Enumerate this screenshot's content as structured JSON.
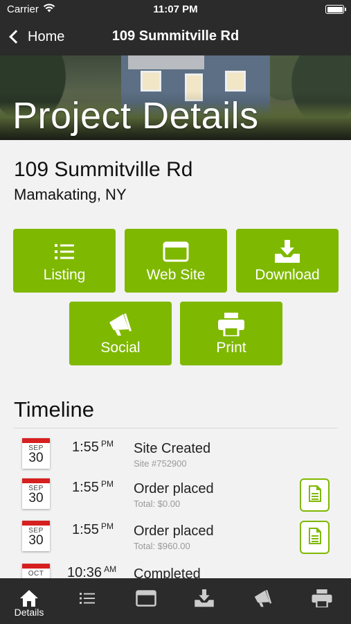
{
  "status_bar": {
    "carrier": "Carrier",
    "time": "11:07 PM"
  },
  "nav": {
    "back_label": "Home",
    "title": "109 Summitville Rd"
  },
  "hero": {
    "heading": "Project Details"
  },
  "address": {
    "street": "109 Summitville Rd",
    "city": "Mamakating, NY"
  },
  "actions": [
    {
      "label": "Listing",
      "icon": "list-icon"
    },
    {
      "label": "Web Site",
      "icon": "browser-window-icon"
    },
    {
      "label": "Download",
      "icon": "download-icon"
    },
    {
      "label": "Social",
      "icon": "megaphone-icon"
    },
    {
      "label": "Print",
      "icon": "printer-icon"
    }
  ],
  "timeline": {
    "title": "Timeline",
    "items": [
      {
        "month": "SEP",
        "day": "30",
        "time": "1:55",
        "ampm": "PM",
        "event": "Site Created",
        "detail": "Site #752900",
        "has_document": false
      },
      {
        "month": "SEP",
        "day": "30",
        "time": "1:55",
        "ampm": "PM",
        "event": "Order placed",
        "detail": "Total: $0.00",
        "has_document": true
      },
      {
        "month": "SEP",
        "day": "30",
        "time": "1:55",
        "ampm": "PM",
        "event": "Order placed",
        "detail": "Total: $960.00",
        "has_document": true
      },
      {
        "month": "OCT",
        "day": "",
        "time": "10:36",
        "ampm": "AM",
        "event": "Completed",
        "detail": "",
        "has_document": false
      }
    ]
  },
  "tab_bar": {
    "active_index": 0,
    "tabs": [
      {
        "label": "Details",
        "icon": "home-icon"
      },
      {
        "label": "",
        "icon": "list-icon"
      },
      {
        "label": "",
        "icon": "browser-window-icon"
      },
      {
        "label": "",
        "icon": "download-icon"
      },
      {
        "label": "",
        "icon": "megaphone-icon"
      },
      {
        "label": "",
        "icon": "printer-icon"
      }
    ]
  },
  "colors": {
    "accent": "#7fb800",
    "bar": "#2b2b2b",
    "calendar_red": "#d61f1f"
  }
}
